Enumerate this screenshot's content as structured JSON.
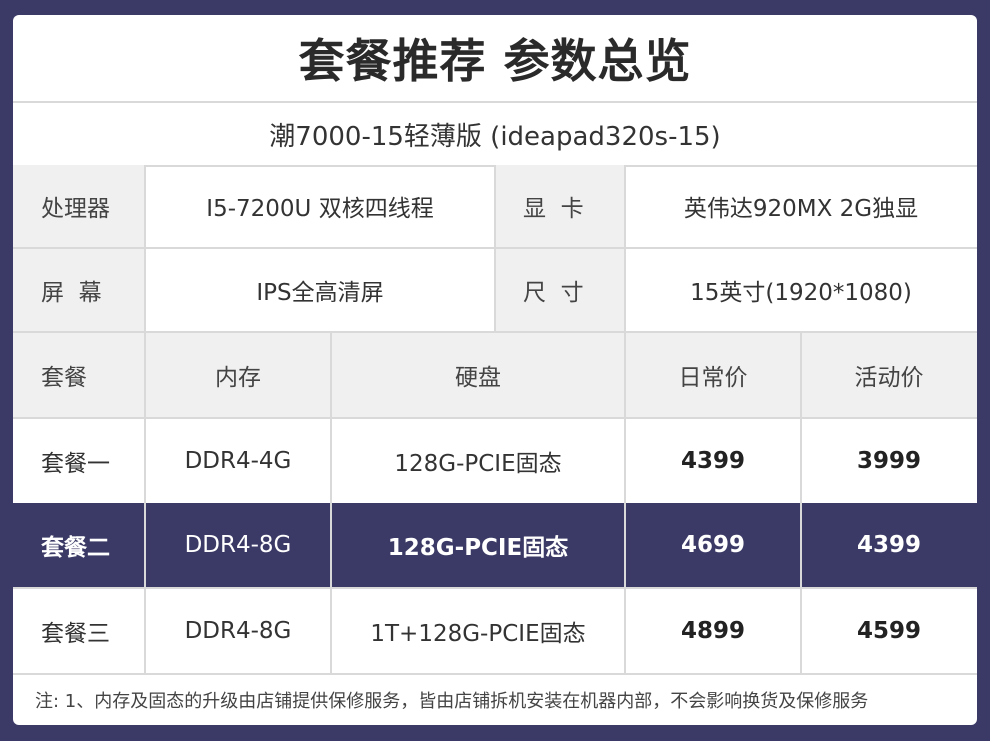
{
  "title": "套餐推荐 参数总览",
  "model": "潮7000-15轻薄版 (ideapad320s-15)",
  "specs": {
    "cpu_label": "处理器",
    "cpu_value": "I5-7200U 双核四线程",
    "gpu_label": "显  卡",
    "gpu_value": "英伟达920MX 2G独显",
    "screen_label": "屏  幕",
    "screen_value": "IPS全高清屏",
    "size_label": "尺  寸",
    "size_value": "15英寸(1920*1080)"
  },
  "table": {
    "headers": [
      "套餐",
      "内存",
      "硬盘",
      "日常价",
      "活动价"
    ],
    "rows": [
      [
        "套餐一",
        "DDR4-4G",
        "128G-PCIE固态",
        "4399",
        "3999"
      ],
      [
        "套餐二",
        "DDR4-8G",
        "128G-PCIE固态",
        "4699",
        "4399"
      ],
      [
        "套餐三",
        "DDR4-8G",
        "1T+128G-PCIE固态",
        "4899",
        "4599"
      ]
    ],
    "highlight_row": 1
  },
  "note": "注: 1、内存及固态的升级由店铺提供保修服务，皆由店铺拆机安装在机器内部，不会影响换货及保修服务",
  "colors": {
    "background": "#3b3a66",
    "highlight_row": "#3b3a66",
    "label_bg": "#f0f0f0",
    "border": "#d9d9d9"
  }
}
